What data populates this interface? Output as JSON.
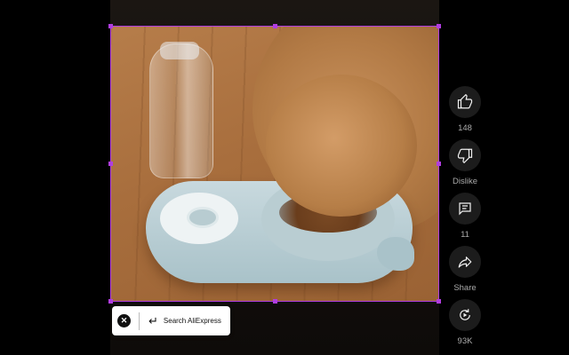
{
  "video": {
    "scene": "dog-eating-from-pet-feeder"
  },
  "sidebar": {
    "like": {
      "icon": "thumbs-up-icon",
      "count": "148"
    },
    "dislike": {
      "icon": "thumbs-down-icon",
      "label": "Dislike"
    },
    "comments": {
      "icon": "comment-icon",
      "count": "11"
    },
    "share": {
      "icon": "share-icon",
      "label": "Share"
    },
    "remix": {
      "icon": "remix-icon",
      "count": "93K"
    }
  },
  "search_popup": {
    "close_icon": "close-icon",
    "enter_icon": "enter-arrow-icon",
    "text": "Search AliExpress"
  },
  "colors": {
    "selection": "#b13de0",
    "background": "#000000",
    "button_bg": "#1c1c1c",
    "label": "#aaaaaa"
  }
}
